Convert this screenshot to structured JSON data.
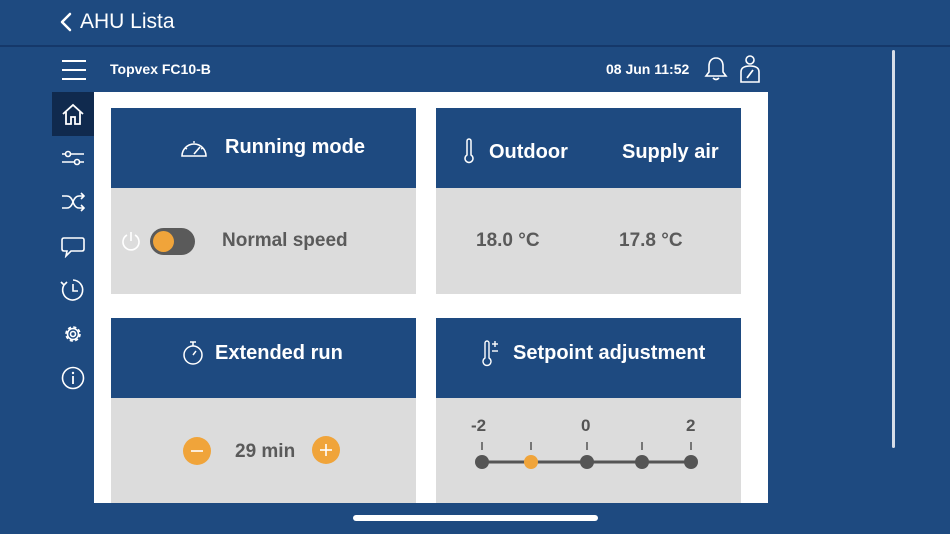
{
  "nav": {
    "back_label": "AHU Lista"
  },
  "header": {
    "unit_name": "Topvex FC10-B",
    "datetime": "08 Jun 11:52"
  },
  "sidebar": {
    "items": [
      "home-icon",
      "sliders-icon",
      "shuffle-icon",
      "chat-icon",
      "clock-icon",
      "gear-icon",
      "info-icon"
    ],
    "active": "home-icon"
  },
  "running_mode": {
    "title": "Running mode",
    "status": "Normal speed",
    "switch_on": false
  },
  "temperatures": {
    "outdoor_label": "Outdoor",
    "supply_label": "Supply air",
    "outdoor_value": "18.0 °C",
    "supply_value": "17.8 °C"
  },
  "extended_run": {
    "title": "Extended run",
    "value": "29 min"
  },
  "setpoint": {
    "title": "Setpoint adjustment",
    "ticks": [
      "-2",
      "0",
      "2"
    ],
    "selected_index": 1
  },
  "colors": {
    "primary": "#1e4a80",
    "accent": "#f0a43a",
    "card_bg": "#dcdcdc"
  }
}
